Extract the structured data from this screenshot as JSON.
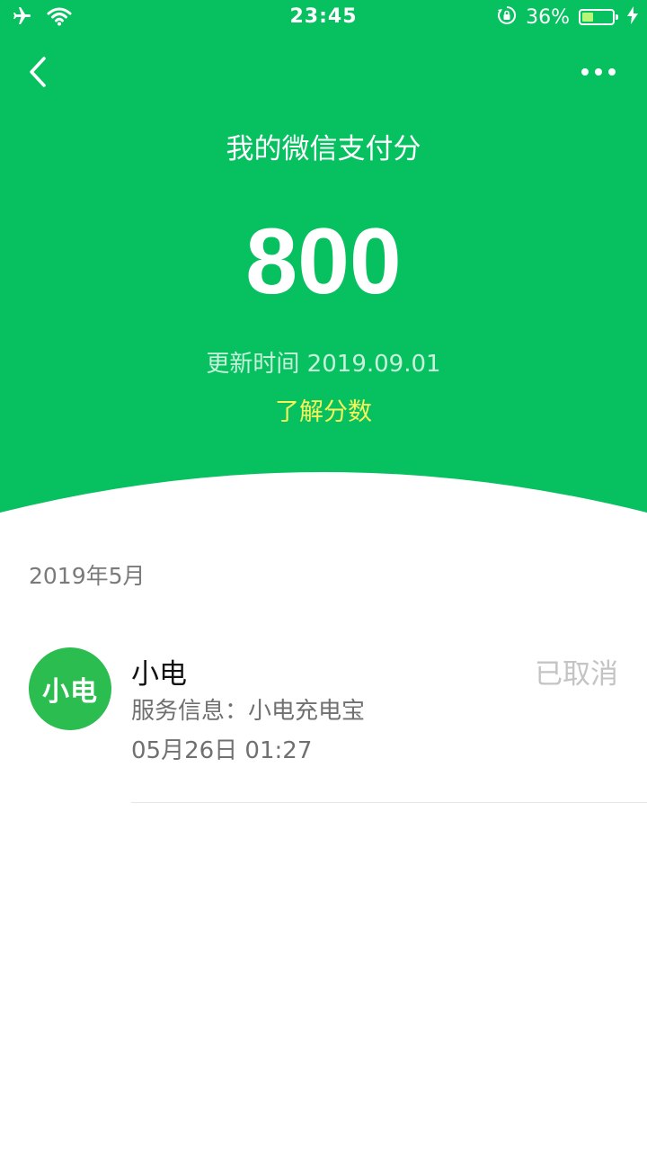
{
  "status_bar": {
    "time": "23:45",
    "battery_percent_text": "36%",
    "battery_level": 0.36,
    "icons": [
      "airplane-icon",
      "wifi-icon",
      "rotation-lock-icon",
      "battery-icon",
      "charging-icon"
    ]
  },
  "header": {
    "back_icon": "chevron-left-icon",
    "more_icon": "more-dots-icon",
    "title": "我的微信支付分",
    "score": "800",
    "update_text": "更新时间 2019.09.01",
    "learn_link": "了解分数"
  },
  "records": {
    "month": "2019年5月",
    "items": [
      {
        "avatar_text": "小电",
        "name": "小电",
        "service": "服务信息：小电充电宝",
        "time": "05月26日 01:27",
        "status": "已取消"
      }
    ]
  },
  "colors": {
    "brand_green": "#07c160",
    "link_yellow": "#f7f35a",
    "avatar_green": "#2bbd4f",
    "muted_text": "#707070",
    "status_gray": "#c4c4c4"
  }
}
